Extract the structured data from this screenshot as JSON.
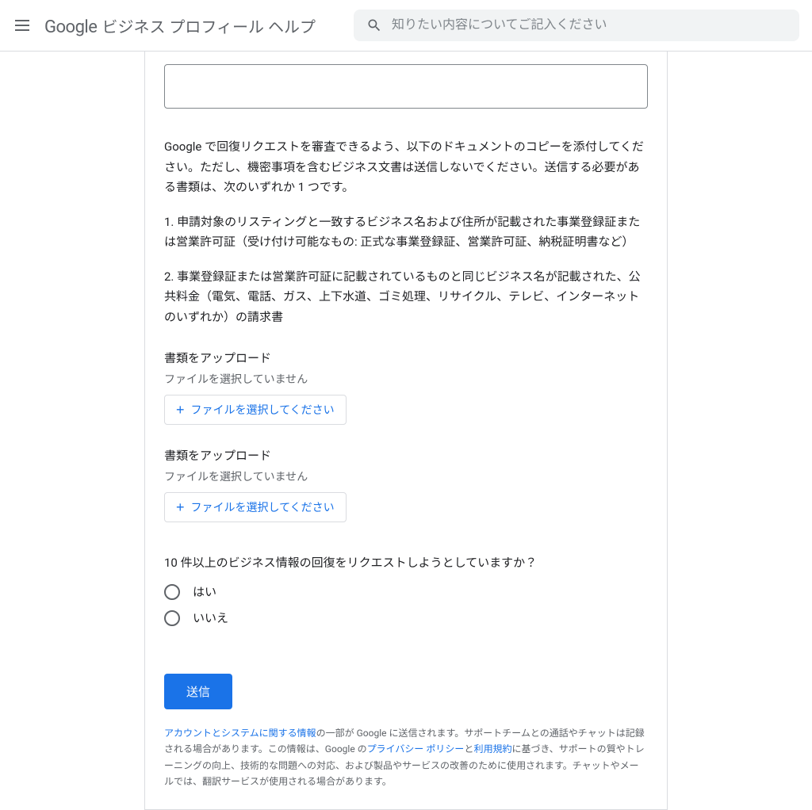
{
  "header": {
    "logo_google": "Google",
    "logo_text": "ビジネス プロフィール ヘルプ",
    "search_placeholder": "知りたい内容についてご記入ください"
  },
  "content": {
    "intro": "Google で回復リクエストを審査できるよう、以下のドキュメントのコピーを添付してください。ただし、機密事項を含むビジネス文書は送信しないでください。送信する必要がある書類は、次のいずれか 1 つです。",
    "item1": "1. 申請対象のリスティングと一致するビジネス名および住所が記載された事業登録証または営業許可証（受け付け可能なもの: 正式な事業登録証、営業許可証、納税証明書など）",
    "item2": "2. 事業登録証または営業許可証に記載されているものと同じビジネス名が記載された、公共料金（電気、電話、ガス、上下水道、ゴミ処理、リサイクル、テレビ、インターネットのいずれか）の請求書"
  },
  "upload1": {
    "label": "書類をアップロード",
    "status": "ファイルを選択していません",
    "button": "ファイルを選択してください"
  },
  "upload2": {
    "label": "書類をアップロード",
    "status": "ファイルを選択していません",
    "button": "ファイルを選択してください"
  },
  "question": {
    "text": "10 件以上のビジネス情報の回復をリクエストしようとしていますか？",
    "yes": "はい",
    "no": "いいえ"
  },
  "submit": "送信",
  "footer": {
    "t1": "アカウントとシステムに関する情報",
    "t2": "の一部が Google に送信されます。サポートチームとの通話やチャットは記録される場合があります。この情報は、Google の",
    "t3": "プライバシー ポリシー",
    "t4": "と",
    "t5": "利用規約",
    "t6": "に基づき、サポートの質やトレーニングの向上、技術的な問題への対応、および製品やサービスの改善のために使用されます。チャットやメールでは、翻訳サービスが使用される場合があります。"
  }
}
